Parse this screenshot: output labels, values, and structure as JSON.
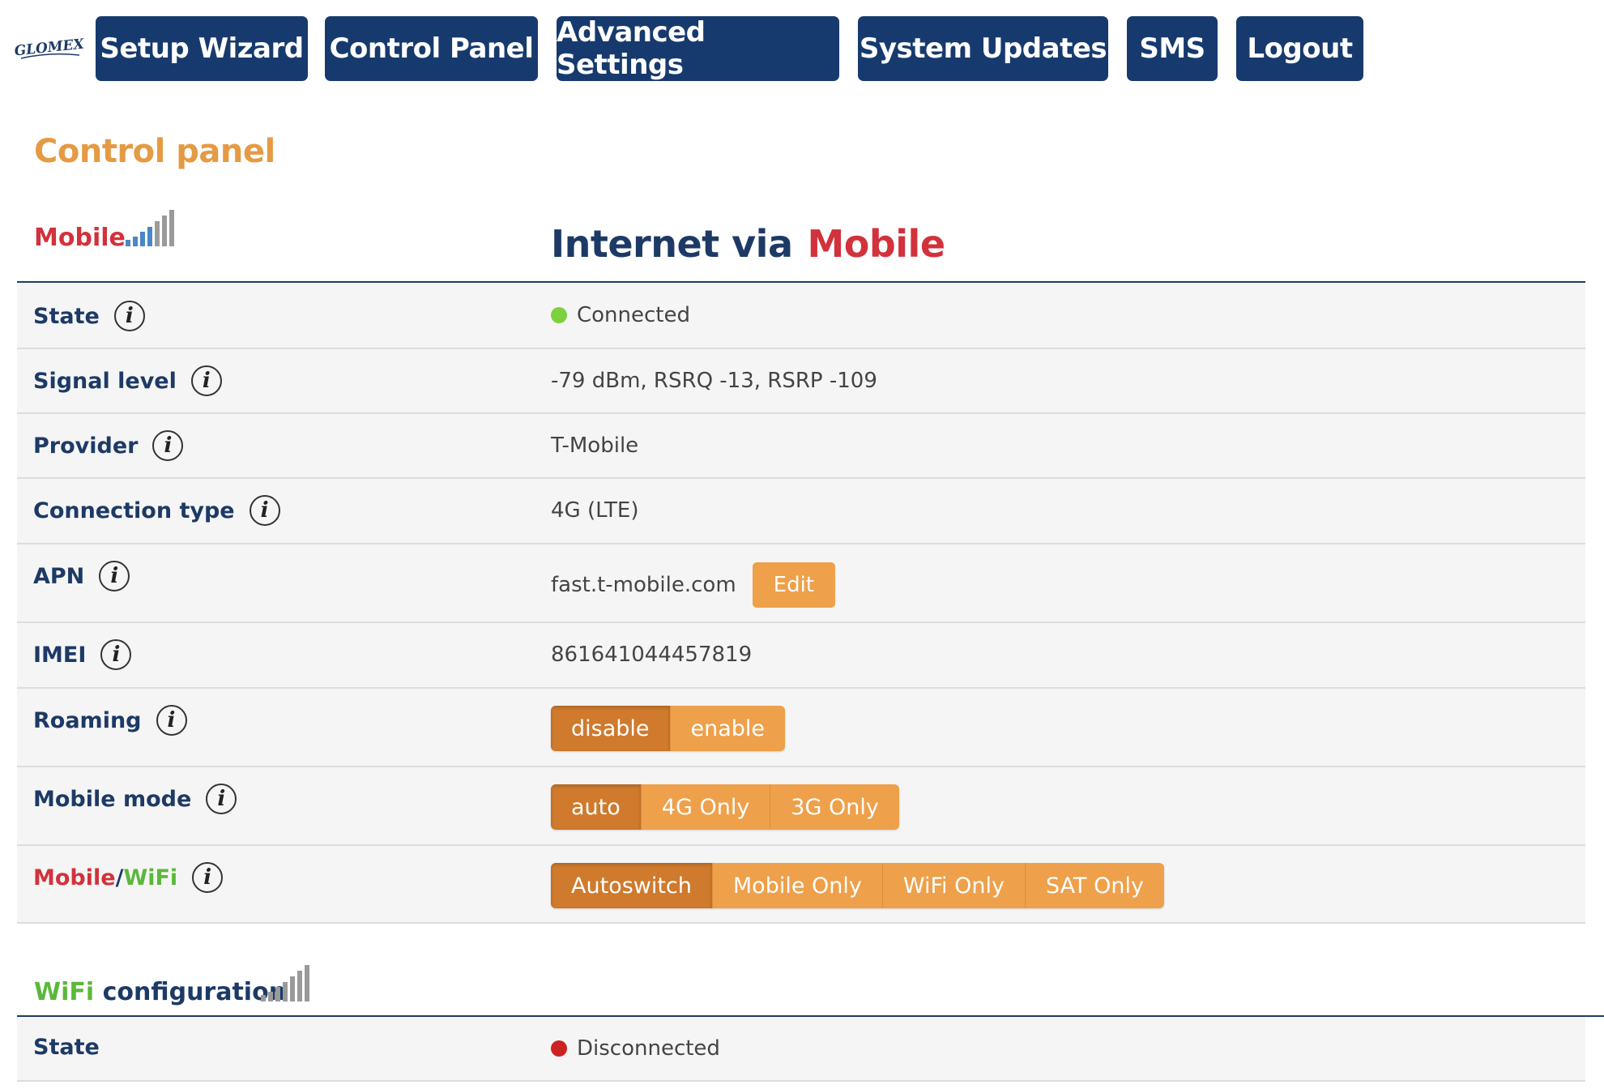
{
  "nav": {
    "logo_text": "GLOMEX",
    "items": [
      "Setup Wizard",
      "Control Panel",
      "Advanced Settings",
      "System Updates",
      "SMS",
      "Logout"
    ]
  },
  "page_title": "Control panel",
  "mobile_section": {
    "label": "Mobile",
    "internet_via_prefix": "Internet via",
    "internet_via_mode": "Mobile",
    "rows": {
      "state": {
        "label": "State",
        "value": "Connected",
        "status_color": "#7dd13e"
      },
      "signal": {
        "label": "Signal level",
        "value": "-79 dBm, RSRQ -13, RSRP -109"
      },
      "provider": {
        "label": "Provider",
        "value": "T-Mobile"
      },
      "connection": {
        "label": "Connection type",
        "value": "4G (LTE)"
      },
      "apn": {
        "label": "APN",
        "value": "fast.t-mobile.com",
        "edit_label": "Edit"
      },
      "imei": {
        "label": "IMEI",
        "value": "861641044457819"
      },
      "roaming": {
        "label": "Roaming",
        "options": [
          "disable",
          "enable"
        ],
        "selected": "disable"
      },
      "mobile_mode": {
        "label": "Mobile mode",
        "options": [
          "auto",
          "4G Only",
          "3G Only"
        ],
        "selected": "auto"
      },
      "mobile_wifi": {
        "label_mobile": "Mobile",
        "label_sep": "/",
        "label_wifi": "WiFi",
        "options": [
          "Autoswitch",
          "Mobile Only",
          "WiFi Only",
          "SAT Only"
        ],
        "selected": "Autoswitch"
      }
    }
  },
  "wifi_section": {
    "label_wifi": "WiFi",
    "label_rest": "configuration",
    "state": {
      "label": "State",
      "value": "Disconnected",
      "status_color": "#cc2222"
    }
  },
  "colors": {
    "nav": "#173a6e",
    "accent": "#eea04a",
    "accent_active": "#cf7a2c",
    "title": "#e59a43"
  }
}
